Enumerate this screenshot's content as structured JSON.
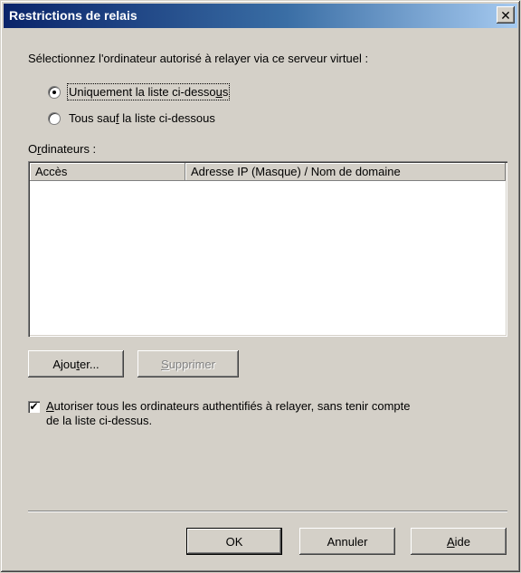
{
  "window": {
    "title": "Restrictions de relais",
    "close_glyph": "✕"
  },
  "prompt": "Sélectionnez l'ordinateur autorisé à relayer via ce serveur virtuel :",
  "radios": [
    {
      "pre": "Uniquement la liste ci-desso",
      "key": "u",
      "post": "s",
      "checked": true
    },
    {
      "pre": "Tous sau",
      "key": "f",
      "post": " la liste ci-dessous",
      "checked": false
    }
  ],
  "computers_label": {
    "pre": "O",
    "key": "r",
    "post": "dinateurs :"
  },
  "list": {
    "columns": [
      "Accès",
      "Adresse IP (Masque) / Nom de domaine"
    ],
    "rows": []
  },
  "buttons": {
    "add": {
      "pre": "Ajou",
      "key": "t",
      "post": "er..."
    },
    "remove": {
      "pre": "",
      "key": "S",
      "post": "upprimer",
      "disabled": true
    },
    "ok": "OK",
    "cancel": "Annuler",
    "help": {
      "pre": "",
      "key": "A",
      "post": "ide"
    }
  },
  "checkbox": {
    "checked": true,
    "check_glyph": "✔",
    "line1_pre": "",
    "line1_key": "A",
    "line1_post": "utoriser tous les ordinateurs authentifiés à relayer, sans tenir compte",
    "line2": "de la liste ci-dessus."
  },
  "icons": {
    "close": "close-icon",
    "check": "check-icon"
  },
  "colors": {
    "face": "#d4d0c8",
    "title_start": "#0a246a",
    "title_end": "#a6caf0"
  }
}
